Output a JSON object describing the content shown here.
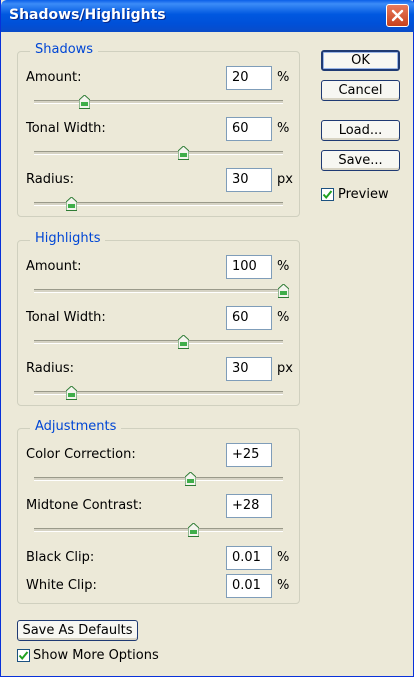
{
  "window": {
    "title": "Shadows/Highlights"
  },
  "shadows": {
    "legend": "Shadows",
    "amount": {
      "label": "Amount:",
      "value": "20",
      "unit": "%",
      "slider_fraction": 0.2
    },
    "tonal_width": {
      "label": "Tonal Width:",
      "value": "60",
      "unit": "%",
      "slider_fraction": 0.6
    },
    "radius": {
      "label": "Radius:",
      "value": "30",
      "unit": "px",
      "slider_fraction": 0.15
    }
  },
  "highlights": {
    "legend": "Highlights",
    "amount": {
      "label": "Amount:",
      "value": "100",
      "unit": "%",
      "slider_fraction": 1.0
    },
    "tonal_width": {
      "label": "Tonal Width:",
      "value": "60",
      "unit": "%",
      "slider_fraction": 0.6
    },
    "radius": {
      "label": "Radius:",
      "value": "30",
      "unit": "px",
      "slider_fraction": 0.15
    }
  },
  "adjustments": {
    "legend": "Adjustments",
    "color_correction": {
      "label": "Color Correction:",
      "value": "+25",
      "slider_fraction": 0.625
    },
    "midtone_contrast": {
      "label": "Midtone Contrast:",
      "value": "+28",
      "slider_fraction": 0.64
    },
    "black_clip": {
      "label": "Black Clip:",
      "value": "0.01",
      "unit": "%"
    },
    "white_clip": {
      "label": "White Clip:",
      "value": "0.01",
      "unit": "%"
    }
  },
  "buttons": {
    "ok": "OK",
    "cancel": "Cancel",
    "load": "Load...",
    "save": "Save...",
    "save_defaults": "Save As Defaults"
  },
  "checkboxes": {
    "preview": {
      "label": "Preview",
      "checked": true
    },
    "more_options": {
      "label": "Show More Options",
      "checked": true
    }
  },
  "colors": {
    "titlebar": "#0058e0",
    "legend_text": "#0046d5",
    "close": "#c8401c"
  }
}
